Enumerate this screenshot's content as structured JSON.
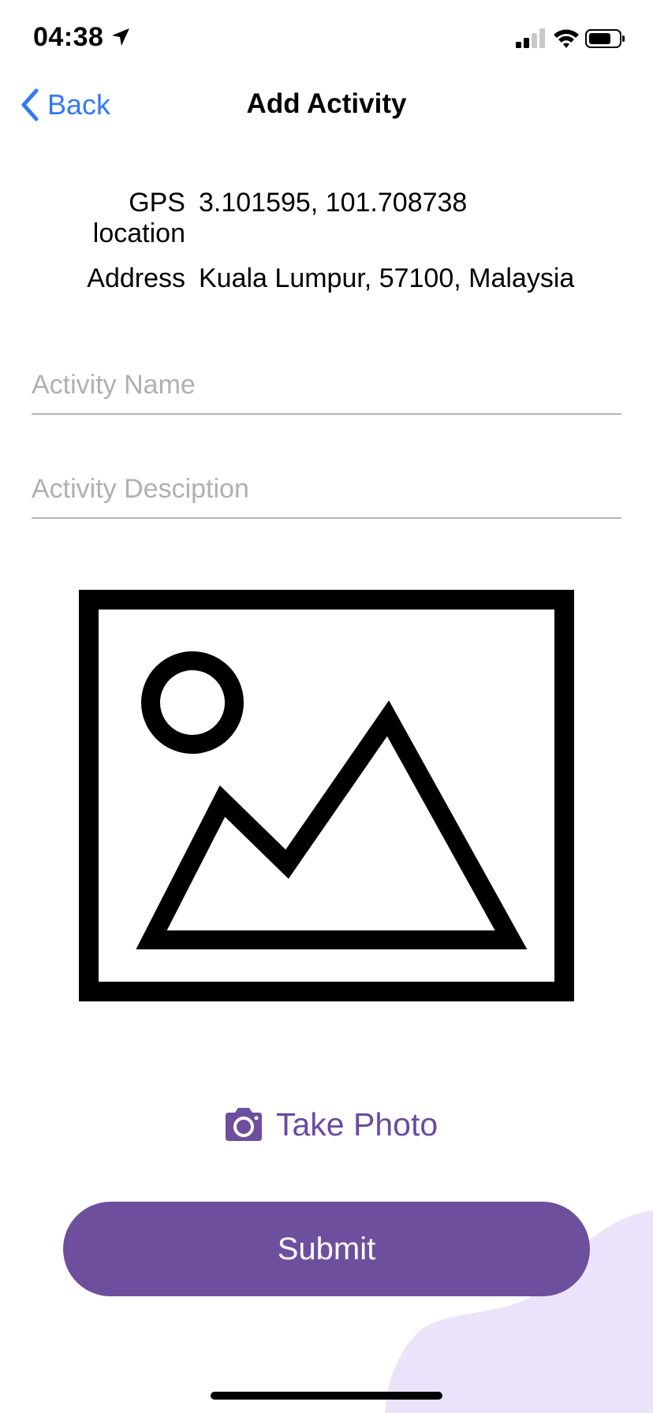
{
  "status_bar": {
    "time": "04:38"
  },
  "nav": {
    "back_label": "Back",
    "title": "Add Activity"
  },
  "info": {
    "gps_label": "GPS location",
    "gps_value": "3.101595, 101.708738",
    "address_label": "Address",
    "address_value": "Kuala Lumpur, 57100, Malaysia"
  },
  "form": {
    "activity_name_placeholder": "Activity Name",
    "activity_name_value": "",
    "activity_description_placeholder": "Activity Desciption",
    "activity_description_value": ""
  },
  "photo": {
    "placeholder_icon": "image-placeholder-icon",
    "take_photo_label": "Take Photo",
    "camera_icon": "camera-icon"
  },
  "actions": {
    "submit_label": "Submit"
  },
  "colors": {
    "accent_purple": "#6e4f9e",
    "link_blue": "#3478f6",
    "blob_lavender": "#ebe3f9"
  }
}
